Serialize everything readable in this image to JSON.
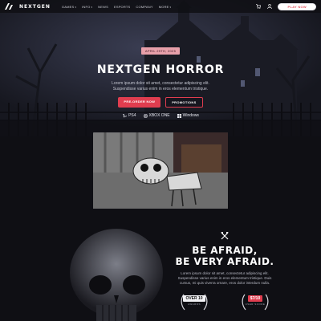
{
  "header": {
    "brand": "NEXTGEN",
    "nav": [
      {
        "label": "GAMES",
        "dropdown": true
      },
      {
        "label": "INFO",
        "dropdown": true
      },
      {
        "label": "NEWS",
        "dropdown": false
      },
      {
        "label": "ESPORTS",
        "dropdown": false
      },
      {
        "label": "COMPANY",
        "dropdown": false
      },
      {
        "label": "MORE",
        "dropdown": true
      }
    ],
    "play_label": "PLAY NOW",
    "icons": [
      "cart-icon",
      "user-icon"
    ]
  },
  "hero": {
    "date": "APRIL 29TH, 2025",
    "title": "NEXTGEN HORROR",
    "text_line1": "Lorem ipsum dolor sit amet, consectetur adipiscing elit.",
    "text_line2": "Suspendisse varius enim in eros elementum tristique.",
    "btn_primary": "PRE-ORDER NOW",
    "btn_secondary": "PROMOTIONS",
    "platforms": [
      {
        "icon": "playstation-icon",
        "label": "PS4"
      },
      {
        "icon": "xbox-icon",
        "label": "XBOX ONE"
      },
      {
        "icon": "windows-icon",
        "label": "Windows"
      }
    ]
  },
  "feature": {
    "title_line1": "BE AFRAID,",
    "title_line2": "BE VERY AFRAID.",
    "text_line1": "Lorem ipsum dolor sit amet, consectetur adipiscing elit.",
    "text_line2": "Suspendisse varius enim in eros elementum tristique. Duis",
    "text_line3": "cursus, mi quis viverra ornare, eros dolor interdum nulla.",
    "awards": [
      {
        "value": "OVER 10",
        "sub": "AWARDS",
        "style": "light"
      },
      {
        "value": "$7/10",
        "sub": "USER SCORE",
        "style": "red"
      }
    ]
  },
  "colors": {
    "accent": "#e03d4f",
    "badge": "#e8a0aa",
    "background": "#0f0f14"
  }
}
